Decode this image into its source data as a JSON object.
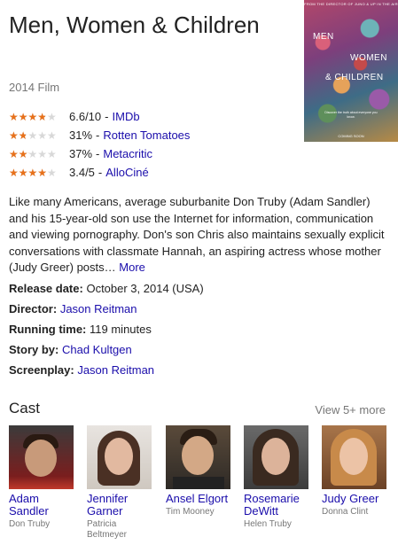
{
  "title": "Men, Women & Children",
  "subtitle": "2014 Film",
  "poster": {
    "top_text": "FROM THE DIRECTOR OF JUNO & UP IN THE AIR",
    "title_line1": "MEN",
    "title_line2": "WOMEN",
    "title_line3": "& CHILDREN",
    "tagline": "Discover the truth about everyone you know.",
    "footer": "COMING SOON"
  },
  "ratings": [
    {
      "score": "6.6/10",
      "source": "IMDb",
      "fraction": 0.66
    },
    {
      "score": "31%",
      "source": "Rotten Tomatoes",
      "fraction": 0.31
    },
    {
      "score": "37%",
      "source": "Metacritic",
      "fraction": 0.37
    },
    {
      "score": "3.4/5",
      "source": "AlloCiné",
      "fraction": 0.68
    }
  ],
  "description": "Like many Americans, average suburbanite Don Truby (Adam Sandler) and his 15-year-old son use the Internet for information, communication and viewing pornography. Don's son Chris also maintains sexually explicit conversations with classmate Hannah, an aspiring actress whose mother (Judy Greer) posts…",
  "description_more": "More",
  "facts": {
    "release_label": "Release date:",
    "release_value": "October 3, 2014 (USA)",
    "director_label": "Director:",
    "director_value": "Jason Reitman",
    "runtime_label": "Running time:",
    "runtime_value": "119 minutes",
    "story_label": "Story by:",
    "story_value": "Chad Kultgen",
    "screenplay_label": "Screenplay:",
    "screenplay_value": "Jason Reitman"
  },
  "cast_heading": "Cast",
  "cast_more": "View 5+ more",
  "cast": [
    {
      "name": "Adam Sandler",
      "role": "Don Truby"
    },
    {
      "name": "Jennifer Garner",
      "role": "Patricia Beltmeyer"
    },
    {
      "name": "Ansel Elgort",
      "role": "Tim Mooney"
    },
    {
      "name": "Rosemarie DeWitt",
      "role": "Helen Truby"
    },
    {
      "name": "Judy Greer",
      "role": "Donna Clint"
    }
  ],
  "colors": {
    "link": "#1a0dab",
    "star": "#e7711b",
    "muted": "#777777"
  }
}
